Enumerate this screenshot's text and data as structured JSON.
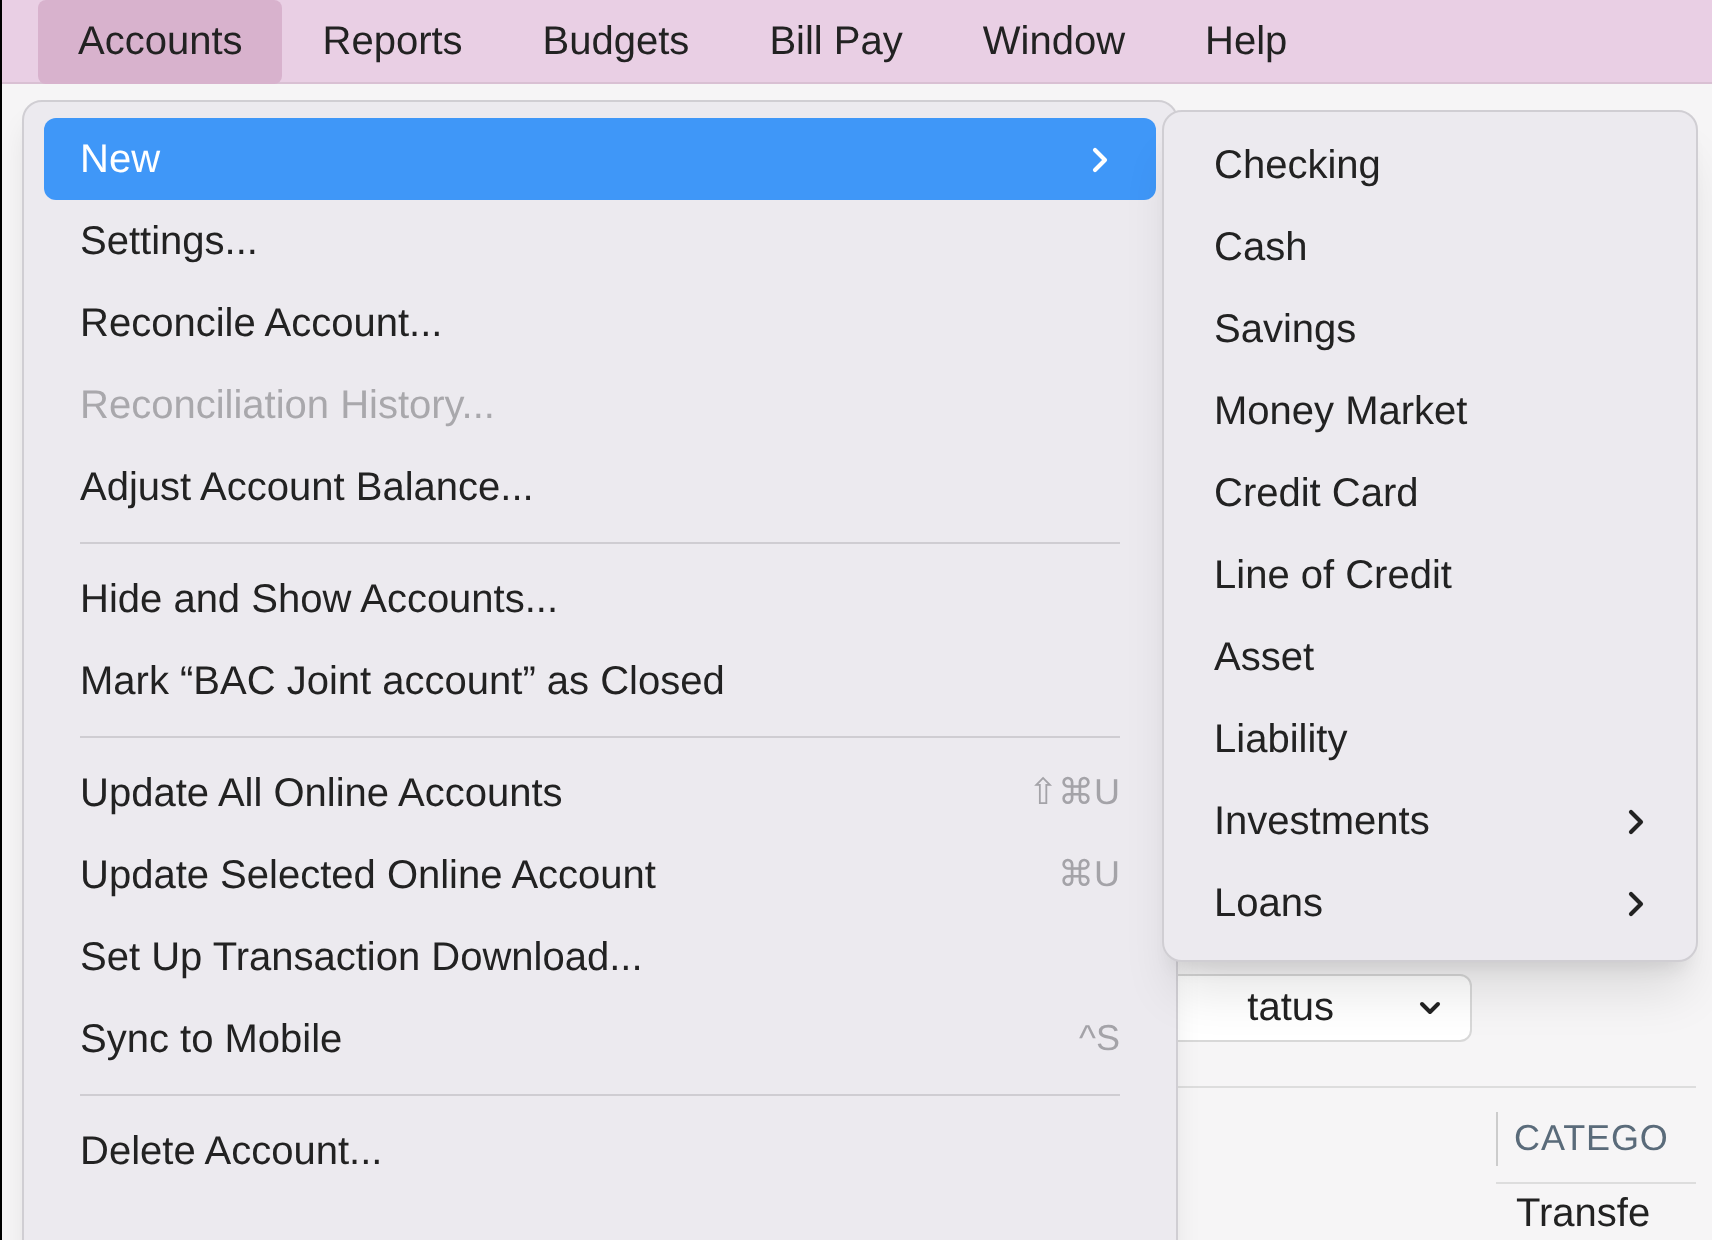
{
  "menu_bar": [
    {
      "label": "Accounts",
      "selected": true
    },
    {
      "label": "Reports",
      "selected": false
    },
    {
      "label": "Budgets",
      "selected": false
    },
    {
      "label": "Bill Pay",
      "selected": false
    },
    {
      "label": "Window",
      "selected": false
    },
    {
      "label": "Help",
      "selected": false
    }
  ],
  "menu": [
    {
      "kind": "item",
      "label": "New",
      "selected": true,
      "disabled": false,
      "submenu": true
    },
    {
      "kind": "item",
      "label": "Settings...",
      "selected": false,
      "disabled": false,
      "submenu": false
    },
    {
      "kind": "item",
      "label": "Reconcile Account...",
      "selected": false,
      "disabled": false,
      "submenu": false
    },
    {
      "kind": "item",
      "label": "Reconciliation History...",
      "selected": false,
      "disabled": true,
      "submenu": false
    },
    {
      "kind": "item",
      "label": "Adjust Account Balance...",
      "selected": false,
      "disabled": false,
      "submenu": false
    },
    {
      "kind": "separator"
    },
    {
      "kind": "item",
      "label": "Hide and Show Accounts...",
      "selected": false,
      "disabled": false,
      "submenu": false
    },
    {
      "kind": "item",
      "label": "Mark “BAC Joint account” as Closed",
      "selected": false,
      "disabled": false,
      "submenu": false
    },
    {
      "kind": "separator"
    },
    {
      "kind": "item",
      "label": "Update All Online Accounts",
      "shortcut": "⇧⌘U",
      "selected": false,
      "disabled": false,
      "submenu": false
    },
    {
      "kind": "item",
      "label": "Update Selected Online Account",
      "shortcut": "⌘U",
      "selected": false,
      "disabled": false,
      "submenu": false
    },
    {
      "kind": "item",
      "label": "Set Up Transaction Download...",
      "selected": false,
      "disabled": false,
      "submenu": false
    },
    {
      "kind": "item",
      "label": "Sync to Mobile",
      "shortcut": "^S",
      "selected": false,
      "disabled": false,
      "submenu": false
    },
    {
      "kind": "separator"
    },
    {
      "kind": "item",
      "label": "Delete Account...",
      "selected": false,
      "disabled": false,
      "submenu": false
    }
  ],
  "submenu": [
    {
      "label": "Checking",
      "submenu": false
    },
    {
      "label": "Cash",
      "submenu": false
    },
    {
      "label": "Savings",
      "submenu": false
    },
    {
      "label": "Money Market",
      "submenu": false
    },
    {
      "label": "Credit Card",
      "submenu": false
    },
    {
      "label": "Line of Credit",
      "submenu": false
    },
    {
      "label": "Asset",
      "submenu": false
    },
    {
      "label": "Liability",
      "submenu": false
    },
    {
      "label": "Investments",
      "submenu": true
    },
    {
      "label": "Loans",
      "submenu": true
    }
  ],
  "background": {
    "status_dropdown": "tatus",
    "column_header": "CATEGO",
    "cell": "Transfe"
  }
}
